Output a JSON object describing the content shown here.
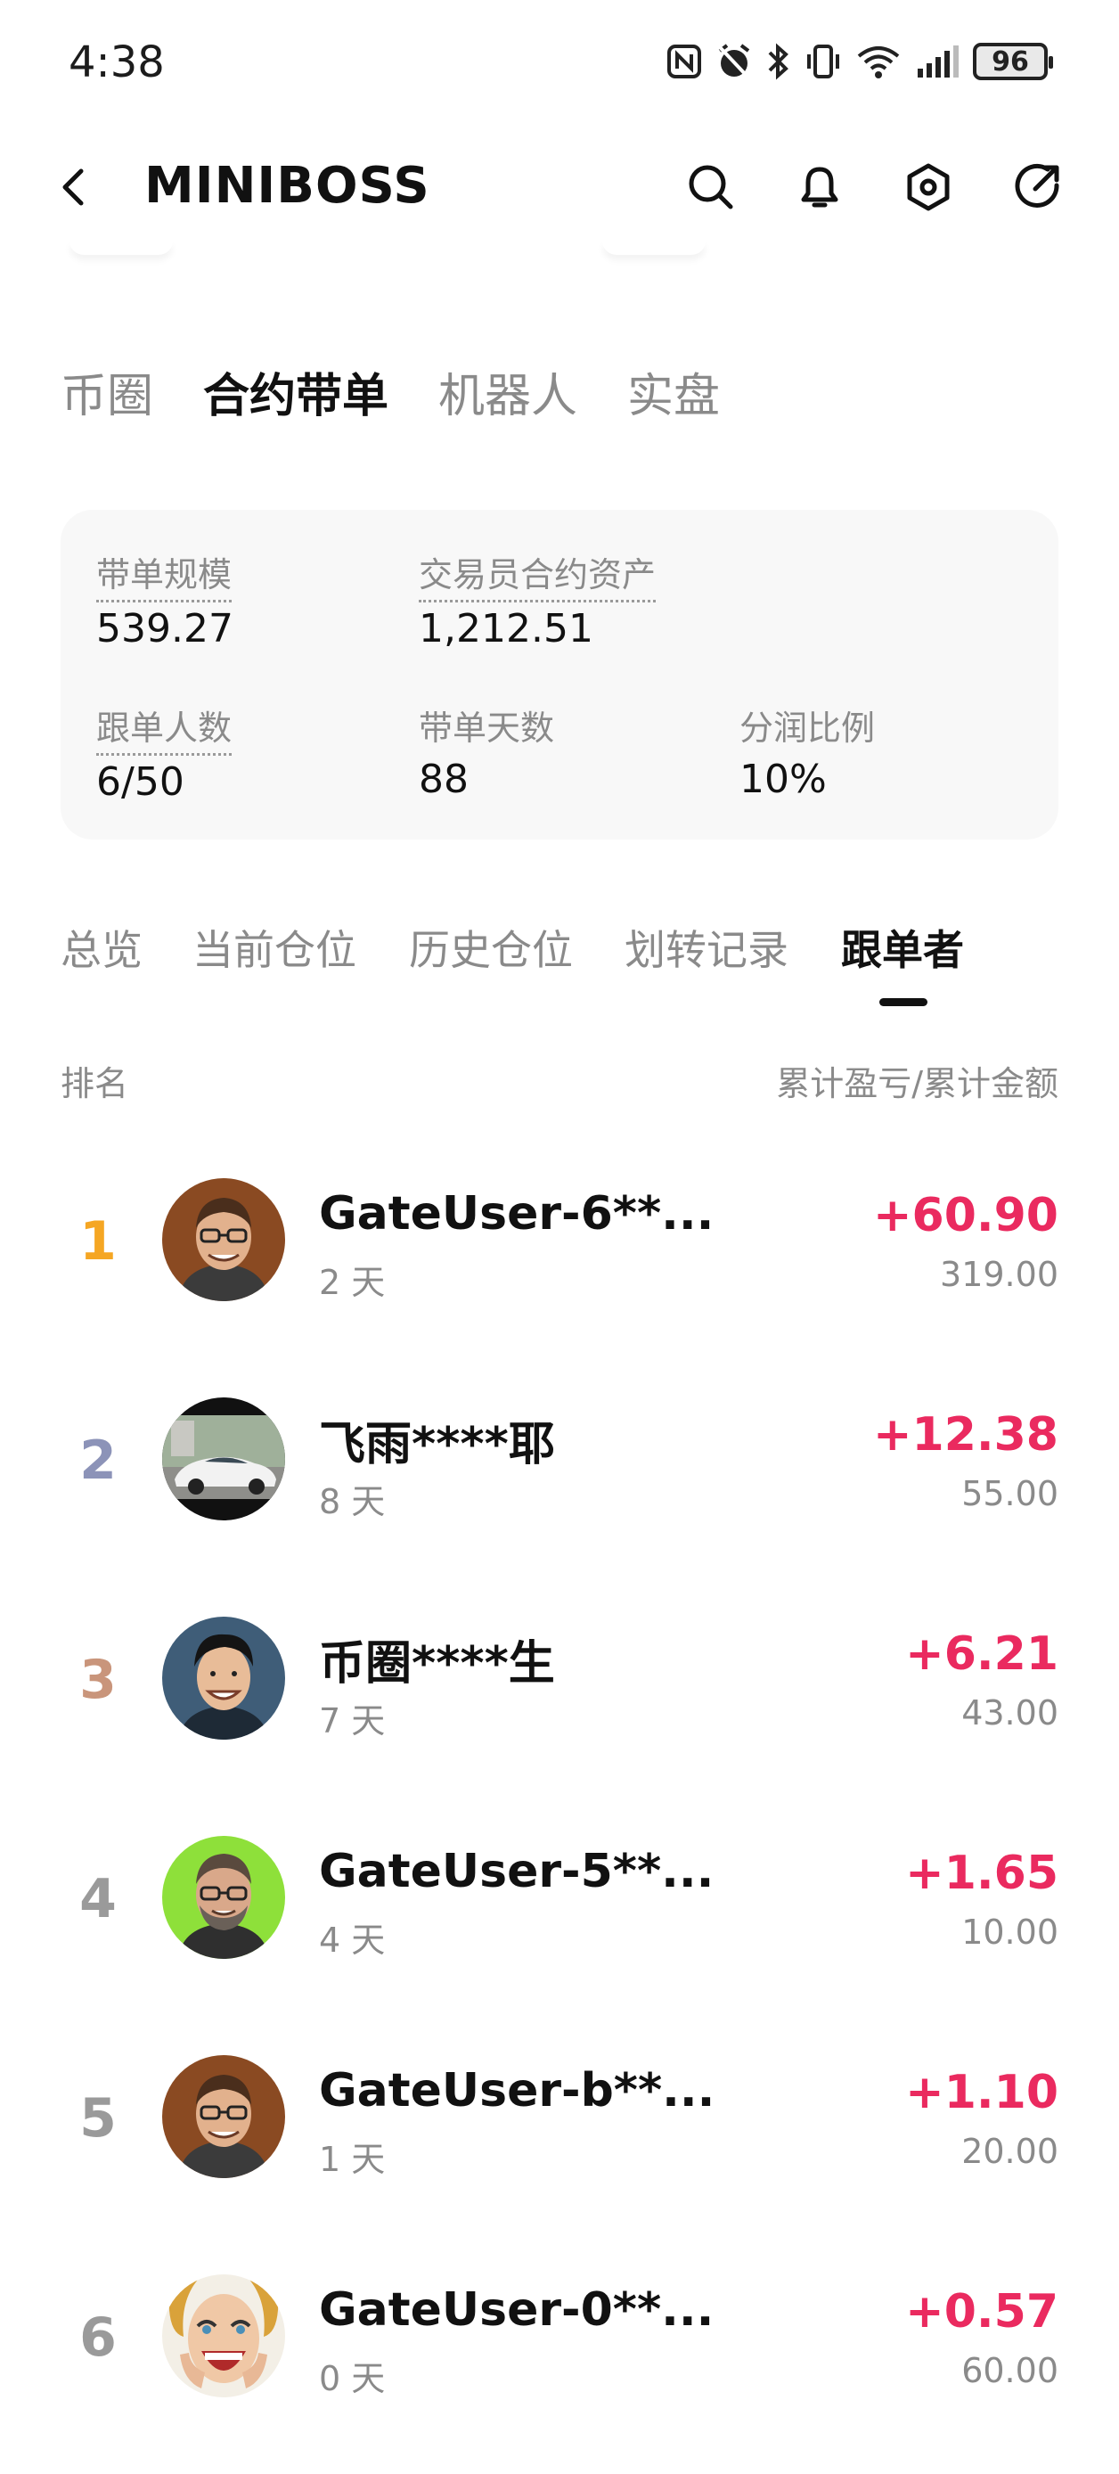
{
  "status_bar": {
    "time": "4:38",
    "battery": "96"
  },
  "header": {
    "title": "MINIBOSS"
  },
  "categories": [
    "币圈",
    "合约带单",
    "机器人",
    "实盘"
  ],
  "summary": {
    "scale_label": "带单规模",
    "scale_value": "539.27",
    "assets_label": "交易员合约资产",
    "assets_value": "1,212.51",
    "followers_label": "跟单人数",
    "followers_value": "6/50",
    "days_label": "带单天数",
    "days_value": "88",
    "share_label": "分润比例",
    "share_value": "10%"
  },
  "sub_tabs": [
    "总览",
    "当前仓位",
    "历史仓位",
    "划转记录",
    "跟单者"
  ],
  "list_header": {
    "rank_label": "排名",
    "value_label": "累计盈亏/累计金额"
  },
  "followers": [
    {
      "rank": "1",
      "name": "GateUser-6**...",
      "days": "2 天",
      "pnl": "+60.90",
      "amount": "319.00",
      "rank_color": "#f5a623"
    },
    {
      "rank": "2",
      "name": "飞雨****耶",
      "days": "8 天",
      "pnl": "+12.38",
      "amount": "55.00",
      "rank_color": "#8c93b8"
    },
    {
      "rank": "3",
      "name": "币圈****生",
      "days": "7 天",
      "pnl": "+6.21",
      "amount": "43.00",
      "rank_color": "#c9957b"
    },
    {
      "rank": "4",
      "name": "GateUser-5**...",
      "days": "4 天",
      "pnl": "+1.65",
      "amount": "10.00",
      "rank_color": "#9a9a9a"
    },
    {
      "rank": "5",
      "name": "GateUser-b**...",
      "days": "1 天",
      "pnl": "+1.10",
      "amount": "20.00",
      "rank_color": "#9a9a9a"
    },
    {
      "rank": "6",
      "name": "GateUser-0**...",
      "days": "0 天",
      "pnl": "+0.57",
      "amount": "60.00",
      "rank_color": "#9a9a9a"
    }
  ],
  "colors": {
    "profit": "#ea2a5f",
    "active_tab": "#111111",
    "muted": "#8a8a8a",
    "card_bg": "#f8f8f8"
  }
}
